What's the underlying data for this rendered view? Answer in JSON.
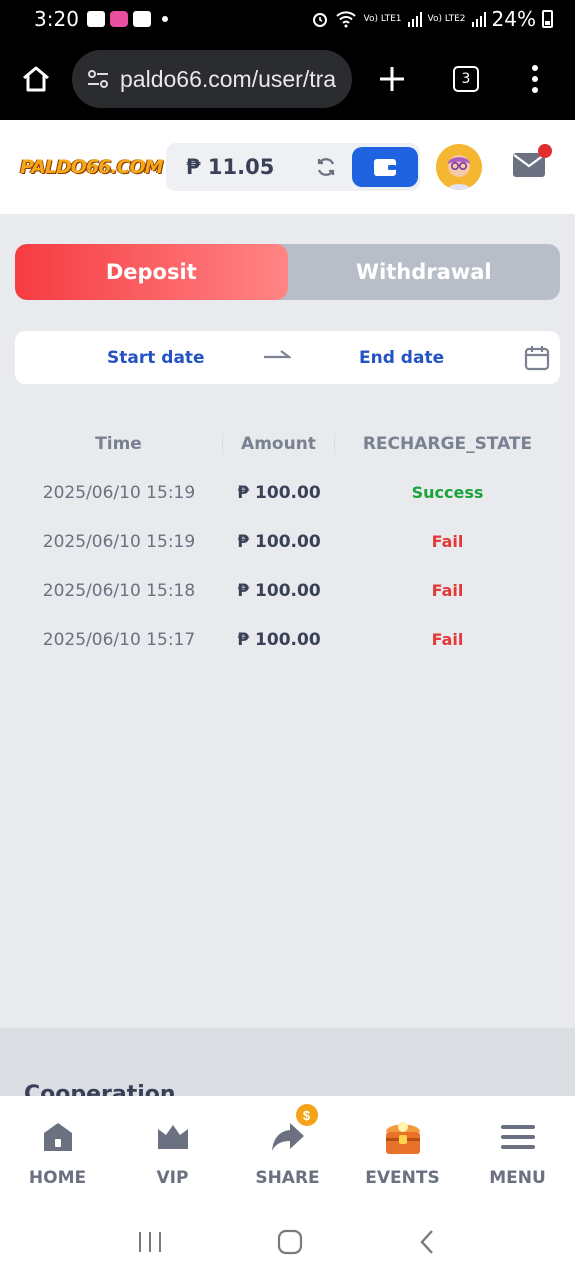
{
  "status_bar": {
    "time": "3:20",
    "sim1": "Vo) LTE1",
    "sim2": "Vo) LTE2",
    "battery": "24%"
  },
  "browser": {
    "url": "paldo66.com/user/tra",
    "tab_count": "3"
  },
  "header": {
    "logo_text": "PALDO66.COM",
    "balance": "₱ 11.05"
  },
  "tabs": {
    "deposit": "Deposit",
    "withdrawal": "Withdrawal",
    "active": "deposit"
  },
  "date_filter": {
    "start": "Start date",
    "end": "End date"
  },
  "table": {
    "headers": [
      "Time",
      "Amount",
      "RECHARGE_STATE"
    ],
    "rows": [
      {
        "time": "2025/06/10 15:19",
        "amount": "₱ 100.00",
        "state": "Success"
      },
      {
        "time": "2025/06/10 15:19",
        "amount": "₱ 100.00",
        "state": "Fail"
      },
      {
        "time": "2025/06/10 15:18",
        "amount": "₱ 100.00",
        "state": "Fail"
      },
      {
        "time": "2025/06/10 15:17",
        "amount": "₱ 100.00",
        "state": "Fail"
      }
    ]
  },
  "footer": {
    "cooperation": "Cooperation"
  },
  "bottom_nav": {
    "home": "HOME",
    "vip": "VIP",
    "share": "SHARE",
    "share_coin": "$",
    "events": "EVENTS",
    "menu": "MENU"
  },
  "colors": {
    "accent_blue": "#1f63e0",
    "deposit_red": "#f63b42",
    "success_green": "#1aa33a",
    "fail_red": "#e23a3a"
  }
}
